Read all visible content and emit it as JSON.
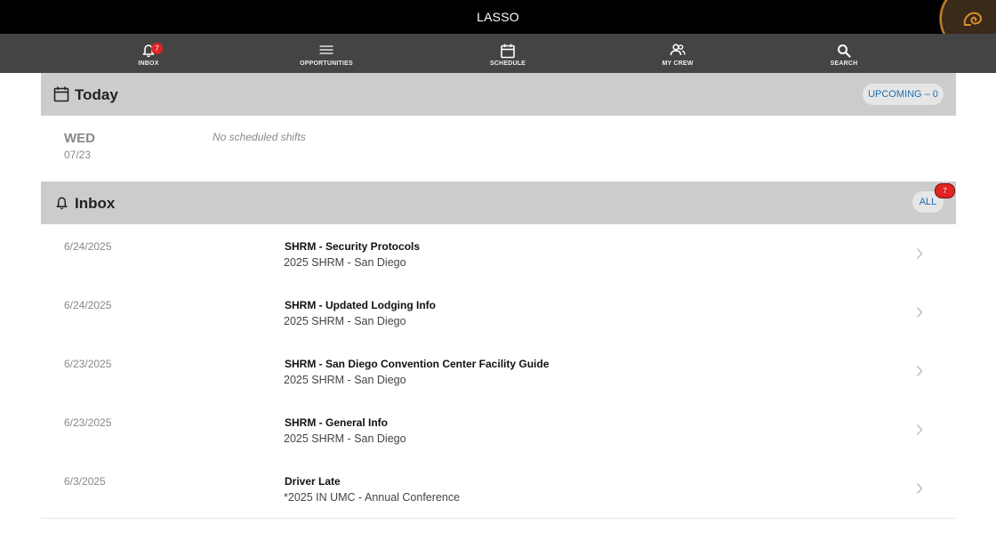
{
  "app": {
    "title": "LASSO"
  },
  "nav": [
    {
      "key": "inbox",
      "label": "INBOX",
      "icon": "bell-icon",
      "badge": "7"
    },
    {
      "key": "opportunities",
      "label": "OPPORTUNITIES",
      "icon": "list-icon"
    },
    {
      "key": "schedule",
      "label": "SCHEDULE",
      "icon": "calendar-icon"
    },
    {
      "key": "my-crew",
      "label": "MY CREW",
      "icon": "people-icon"
    },
    {
      "key": "search",
      "label": "SEARCH",
      "icon": "search-icon"
    }
  ],
  "today": {
    "title": "Today",
    "upcoming_label": "UPCOMING – 0",
    "day": "WED",
    "date": "07/23",
    "empty_text": "No scheduled shifts"
  },
  "inbox": {
    "title": "Inbox",
    "all_label": "ALL",
    "badge": "7",
    "items": [
      {
        "date": "6/24/2025",
        "title": "SHRM - Security Protocols",
        "subtitle": "2025 SHRM - San Diego"
      },
      {
        "date": "6/24/2025",
        "title": "SHRM - Updated Lodging Info",
        "subtitle": "2025 SHRM - San Diego"
      },
      {
        "date": "6/23/2025",
        "title": "SHRM - San Diego Convention Center Facility Guide",
        "subtitle": "2025 SHRM - San Diego"
      },
      {
        "date": "6/23/2025",
        "title": "SHRM - General Info",
        "subtitle": "2025 SHRM - San Diego"
      },
      {
        "date": "6/3/2025",
        "title": "Driver Late",
        "subtitle": "*2025 IN UMC - Annual Conference"
      }
    ]
  },
  "colors": {
    "topbar": "#000000",
    "navbar": "#444444",
    "section_header": "#cccccc",
    "accent_blue": "#1f6fb2",
    "badge_red": "#e02525",
    "assistant_orange": "#c8832e"
  }
}
